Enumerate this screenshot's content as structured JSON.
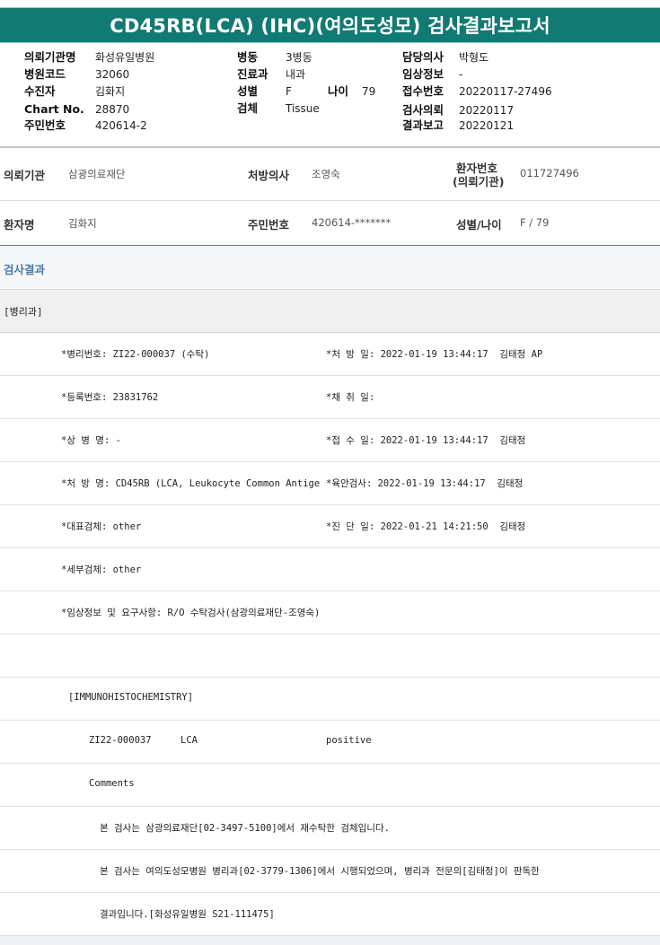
{
  "title": "CD45RB(LCA) (IHC)(여의도성모) 검사결과보고서",
  "header_info": {
    "col1": [
      {
        "label": "의뢰기관명",
        "value": "화성유일병원"
      },
      {
        "label": "병원코드",
        "value": "32060"
      },
      {
        "label": "수진자",
        "value": "김화지"
      },
      {
        "label": "Chart No.",
        "value": "28870"
      },
      {
        "label": "주민번호",
        "value": "420614-2"
      }
    ],
    "col2": [
      {
        "label": "병동",
        "value": "3병동"
      },
      {
        "label": "진료과",
        "value": "내과"
      },
      {
        "label": "성별",
        "value": "F"
      },
      {
        "label": "검체",
        "value": "Tissue"
      }
    ],
    "age": {
      "label": "나이",
      "value": "79"
    },
    "col3": [
      {
        "label": "담당의사",
        "value": "박형도"
      },
      {
        "label": "임상정보",
        "value": "-"
      },
      {
        "label": "접수번호",
        "value": "20220117-27496"
      },
      {
        "label": "검사의뢰",
        "value": "20220117"
      },
      {
        "label": "결과보고",
        "value": "20220121"
      }
    ]
  },
  "patient_table": {
    "row1": {
      "institution_label": "의뢰기관",
      "institution_value": "삼광의료재단",
      "doctor_label": "처방의사",
      "doctor_value": "조영숙",
      "patient_no_label_1": "환자번호",
      "patient_no_label_2": "(의뢰기관)",
      "patient_no_value": "011727496"
    },
    "row2": {
      "name_label": "환자명",
      "name_value": "김화지",
      "resident_label": "주민번호",
      "resident_value": "420614-*******",
      "sex_age_label": "성별/나이",
      "sex_age_value": "F / 79"
    }
  },
  "section_title": "검사결과",
  "department": "[병리과]",
  "report_lines": [
    {
      "left": "*병리번호: ZI22-000037 (수탁)",
      "right": "*처 방 일: 2022-01-19 13:44:17  김태정 AP"
    },
    {
      "left": "*등록번호: 23831762",
      "right": "*채 취 일:"
    },
    {
      "left": "*상 병 명: -",
      "right": "*접 수 일: 2022-01-19 13:44:17  김태정"
    },
    {
      "left": "*처 방 명: CD45RB (LCA, Leukocyte Common Antige",
      "right": "*육안검사: 2022-01-19 13:44:17  김태정"
    },
    {
      "left": "*대표검체: other",
      "right": "*진 단 일: 2022-01-21 14:21:50  김태정"
    },
    {
      "left": "*세부검체: other",
      "right": ""
    },
    {
      "left": "*임상정보 및 요구사항: R/O 수탁검사(삼광의료재단-조영숙)",
      "right": ""
    }
  ],
  "ihc_header": "[IMMUNOHISTOCHEMISTRY]",
  "ihc_result": {
    "pathology_no": "ZI22-000037",
    "marker": "LCA",
    "result": "positive"
  },
  "comments_label": "Comments",
  "comment_lines": [
    "본 검사는 삼광의료재단[02-3497-5100]에서 재수탁한 검체입니다.",
    "본 검사는 여의도성모병원 병리과[02-3779-1306]에서 시행되었으며, 병리과 전문의[김태정]이 판독한",
    "결과입니다.[화성유일병원 S21-111475]"
  ]
}
